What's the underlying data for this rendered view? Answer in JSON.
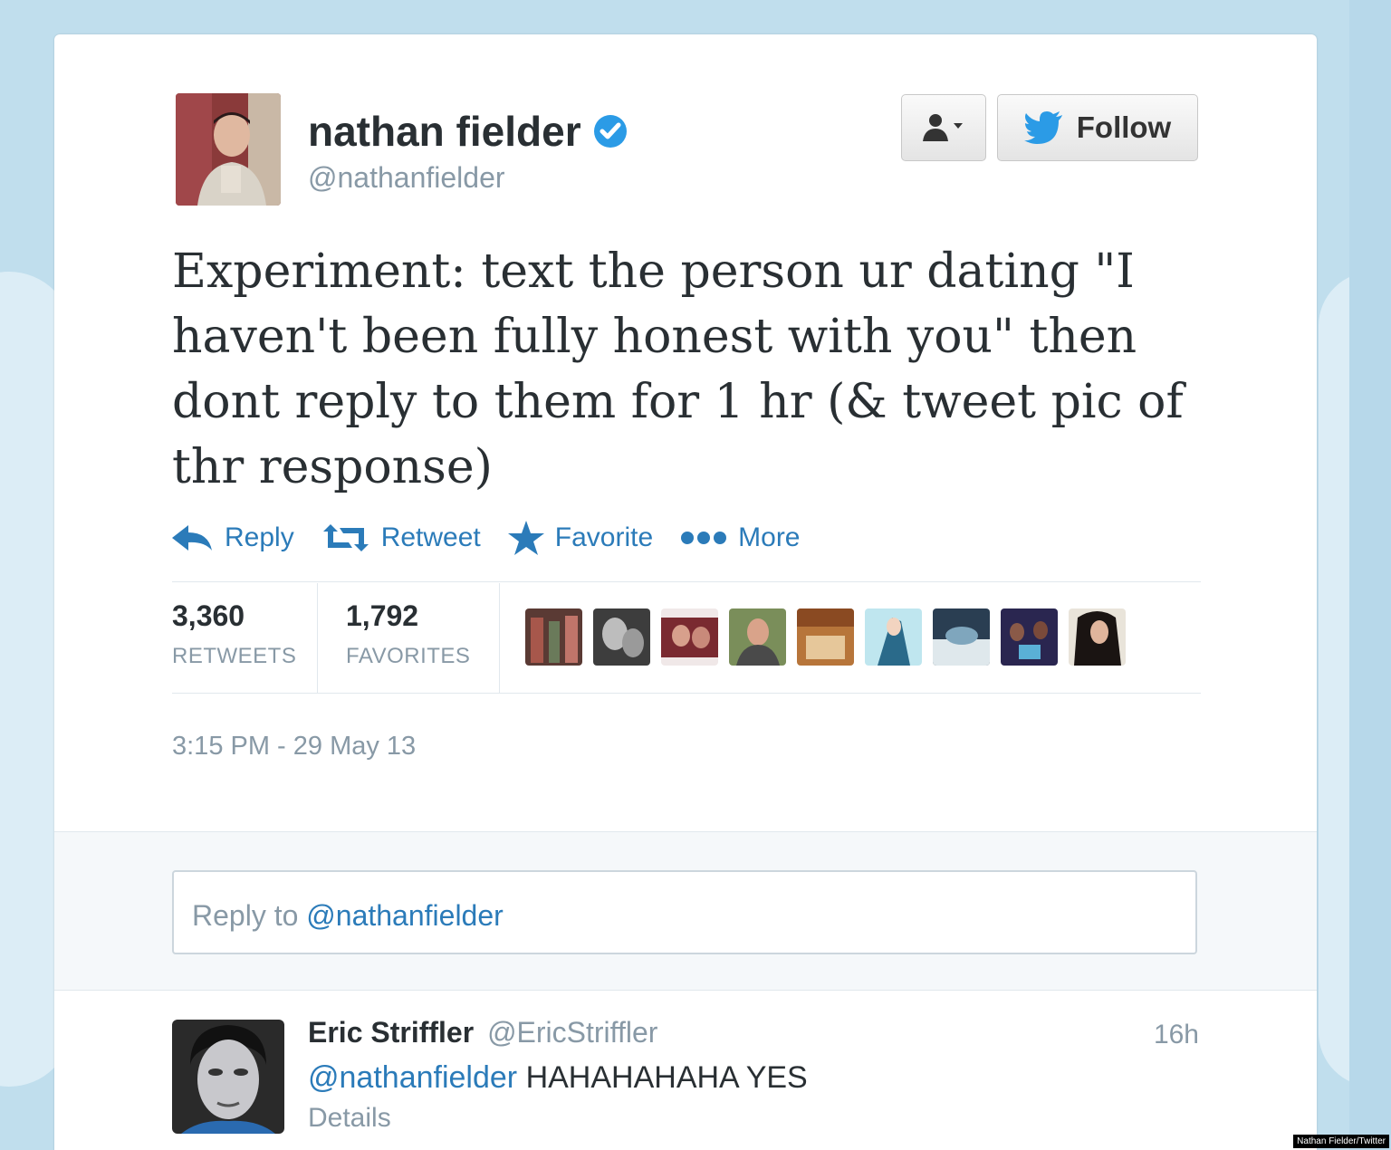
{
  "tweet": {
    "author_name": "nathan fielder",
    "author_handle": "@nathanfielder",
    "text": "Experiment: text the person ur dating \"I haven't been fully honest with you\" then dont reply to them for 1 hr (& tweet pic of thr response)",
    "follow_label": "Follow",
    "actions": {
      "reply": "Reply",
      "retweet": "Retweet",
      "favorite": "Favorite",
      "more": "More"
    },
    "stats": {
      "retweets_count": "3,360",
      "retweets_label": "RETWEETS",
      "favorites_count": "1,792",
      "favorites_label": "FAVORITES"
    },
    "timestamp": "3:15 PM - 29 May 13"
  },
  "reply_box": {
    "prefix": "Reply to",
    "mention": "@nathanfielder"
  },
  "reply": {
    "author_name": "Eric Striffler",
    "author_handle": "@EricStriffler",
    "time": "16h",
    "mention": "@nathanfielder",
    "text": "HAHAHAHAHA YES",
    "details_label": "Details"
  },
  "credit": "Nathan Fielder/Twitter",
  "colors": {
    "link": "#2b7bb9",
    "muted": "#8899a6",
    "text": "#292f33",
    "background": "#c0deed"
  }
}
